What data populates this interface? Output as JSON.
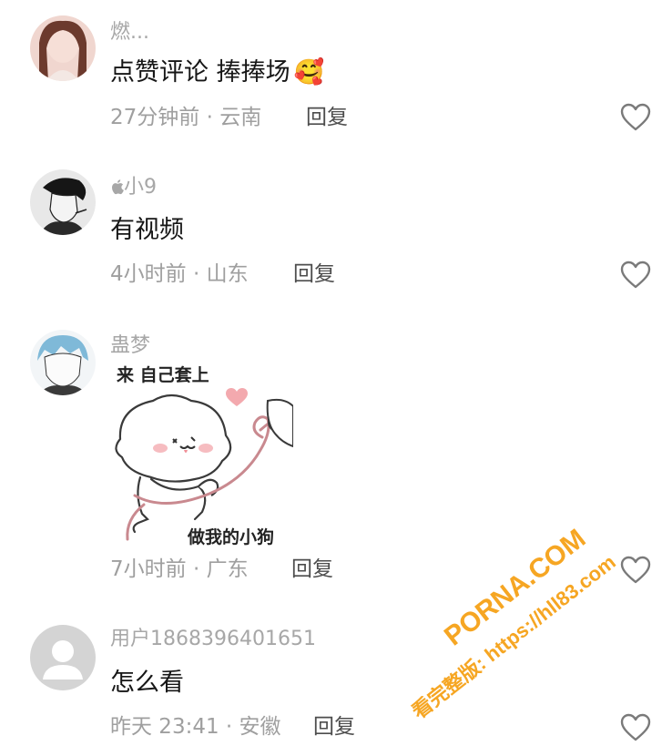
{
  "comments": [
    {
      "username": "燃...",
      "text": "点赞评论 捧捧场",
      "emoji": "🥰",
      "meta": "27分钟前 · 云南",
      "reply_label": "回复"
    },
    {
      "username_prefix_icon": "apple-icon",
      "username": "小9",
      "text": "有视频",
      "meta": "4小时前 · 山东",
      "reply_label": "回复"
    },
    {
      "username": "蛊梦",
      "sticker": {
        "top_text": "来 自己套上",
        "bottom_text": "做我的小狗"
      },
      "meta": "7小时前 · 广东",
      "reply_label": "回复"
    },
    {
      "username": "用户1868396401651",
      "text": "怎么看",
      "meta": "昨天 23:41 · 安徽",
      "reply_label": "回复"
    }
  ],
  "watermark": {
    "site": "PORNA.COM",
    "line2": "看完整版: https://hll83.com"
  }
}
